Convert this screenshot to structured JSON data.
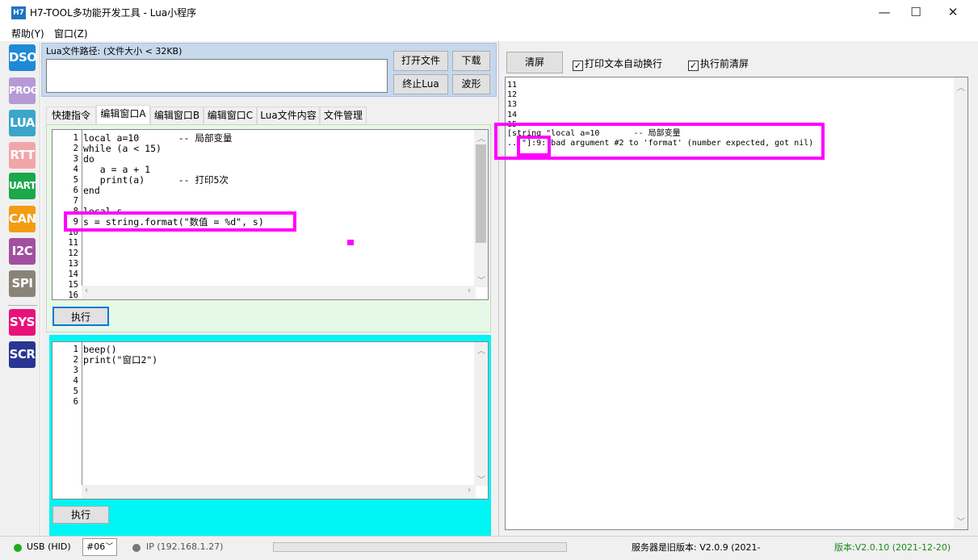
{
  "window": {
    "icon_text": "H7",
    "title": "H7-TOOL多功能开发工具 - Lua小程序",
    "minimize": "—",
    "maximize": "☐",
    "close": "✕"
  },
  "menu": [
    "帮助(Y)",
    "窗口(Z)"
  ],
  "toolbar": [
    {
      "label": "DSO",
      "color": "#1f8ad6"
    },
    {
      "label": "PROG",
      "color": "#b59ad6"
    },
    {
      "label": "LUA",
      "color": "#3aa6c9"
    },
    {
      "label": "RTT",
      "color": "#f2a5a8"
    },
    {
      "label": "UART",
      "color": "#1aa84b"
    },
    {
      "label": "CAN",
      "color": "#f39c12"
    },
    {
      "label": "I2C",
      "color": "#a34fa1"
    },
    {
      "label": "SPI",
      "color": "#8a8478"
    },
    {
      "label": "SYS",
      "color": "#e8127a"
    },
    {
      "label": "SCR",
      "color": "#283593"
    }
  ],
  "lua_path": {
    "label": "Lua文件路径: (文件大小 < 32KB)",
    "value": "",
    "open_button": "打开文件",
    "download_button": "下载",
    "stop_button": "终止Lua",
    "wave_button": "波形"
  },
  "tabs": [
    "快捷指令",
    "编辑窗口A",
    "编辑窗口B",
    "编辑窗口C",
    "Lua文件内容",
    "文件管理"
  ],
  "active_tab": "编辑窗口A",
  "editorA": {
    "line_numbers": [
      "1",
      "2",
      "3",
      "4",
      "5",
      "6",
      "7",
      "8",
      "9",
      "10",
      "11",
      "12",
      "13",
      "14",
      "15",
      "16"
    ],
    "lines": [
      "local a=10       -- 局部变量",
      "while (a < 15)",
      "do",
      "   a = a + 1",
      "   print(a)      -- 打印5次",
      "end",
      "",
      "local s",
      "s = string.format(\"数值 = %d\", s)",
      "",
      "",
      "",
      "",
      "",
      "",
      ""
    ],
    "run_button": "执行"
  },
  "editorB": {
    "line_numbers": [
      "1",
      "2",
      "3",
      "4",
      "5",
      "6"
    ],
    "lines": [
      "beep()",
      "print(\"窗口2\")",
      "",
      "",
      "",
      ""
    ],
    "run_button": "执行"
  },
  "output_panel": {
    "clear_button": "清屏",
    "wrap_checkbox": "打印文本自动换行",
    "wrap_checked": true,
    "clear_before_run_checkbox": "执行前清屏",
    "clear_before_run_checked": true,
    "lines": [
      "11",
      "12",
      "13",
      "14",
      "15",
      "[string \"local a=10       -- 局部变量",
      "...\"]:9: bad argument #2 to 'format' (number expected, got nil)"
    ]
  },
  "status": {
    "usb": "USB (HID)",
    "device": "#06",
    "ip": "IP (192.168.1.27)",
    "server_version": "服务器是旧版本: V2.0.9 (2021-",
    "version": "版本:V2.0.10 (2021-12-20)",
    "usb_color": "#22aa22",
    "ip_color": "#777777",
    "version_color": "#1a8a1a"
  }
}
